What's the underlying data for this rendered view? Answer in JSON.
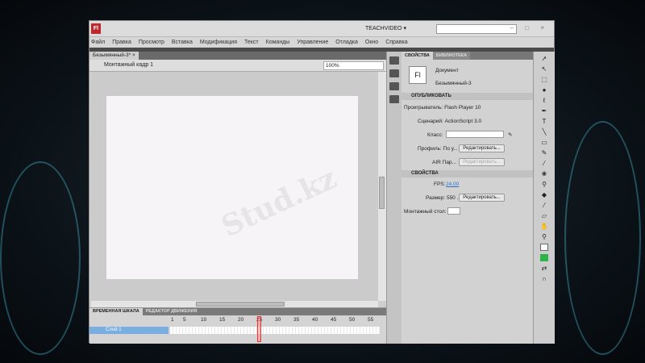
{
  "app": {
    "logo": "Fl",
    "workspace": "TEACHVIDEO ▾",
    "window_controls": "– □ ×"
  },
  "menu": [
    "Файл",
    "Правка",
    "Просмотр",
    "Вставка",
    "Модификация",
    "Текст",
    "Команды",
    "Управление",
    "Отладка",
    "Окно",
    "Справка"
  ],
  "document": {
    "tab": "Безымянный-3* ×",
    "scene": "Монтажный кадр 1",
    "zoom": "100%"
  },
  "timeline": {
    "tabs": [
      "ВРЕМЕННАЯ ШКАЛА",
      "РЕДАКТОР ДВИЖЕНИЯ"
    ],
    "ruler": [
      "1",
      "5",
      "10",
      "15",
      "20",
      "25",
      "30",
      "35",
      "40",
      "45",
      "50",
      "55"
    ],
    "layer": "Слой 1",
    "current_frame": 25
  },
  "properties": {
    "tabs": [
      "СВОЙСТВА",
      "БИБЛИОТЕКА"
    ],
    "doc_icon": "Fl",
    "doc_type": "Документ",
    "doc_name": "Безымянный-3",
    "publish_header": "ОПУБЛИКОВАТЬ",
    "player": "Проигрыватель: Flash Player 10",
    "script": "Сценарий: ActionScript 3.0",
    "class_label": "Класс:",
    "class_value": "",
    "profile": "Профиль: По у...",
    "edit1": "Редактировать...",
    "air": "AIR Пар...",
    "edit2": "Редактировать...",
    "props_header": "СВОЙСТВА",
    "fps_label": "FPS:",
    "fps_value": "24.00",
    "size": "Размер: 550 ...",
    "edit3": "Редактировать...",
    "stage_label": "Монтажный стол:"
  },
  "watermark": "Stud.kz"
}
